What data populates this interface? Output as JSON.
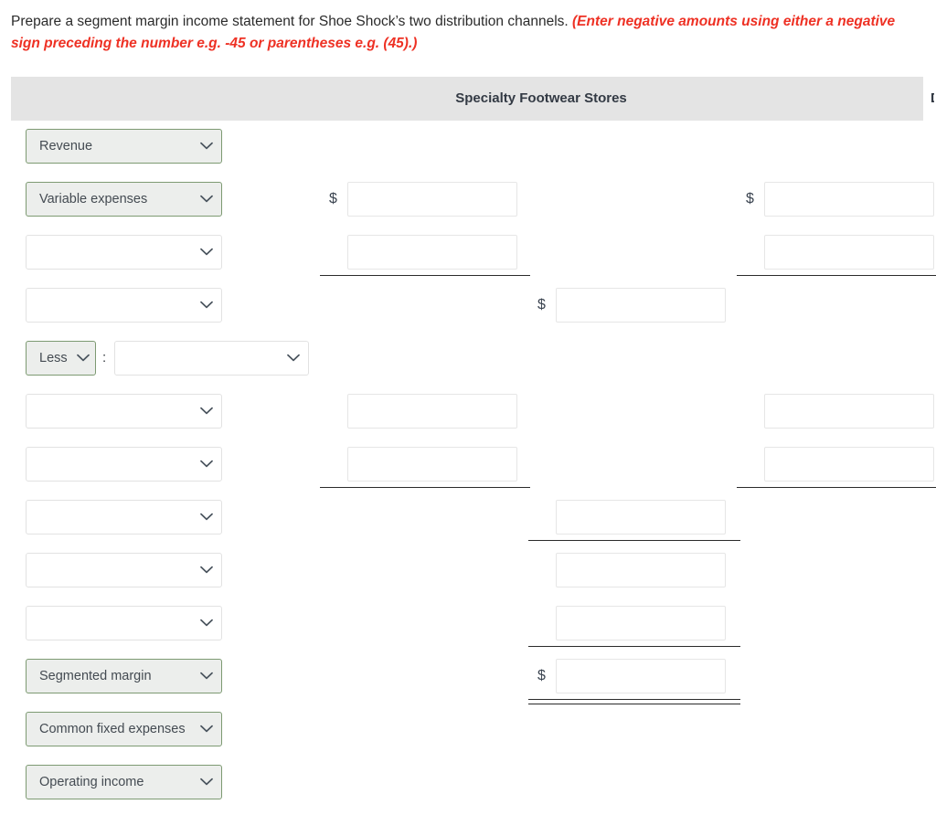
{
  "instructions": {
    "prompt": "Prepare a segment margin income statement for Shoe Shock’s two distribution channels.",
    "hint": "(Enter negative amounts using either a negative sign preceding the number e.g. -45 or parentheses e.g. (45).)"
  },
  "header": {
    "columns": [
      {
        "label": "Specialty Footwear Stores"
      },
      {
        "label": "D"
      }
    ]
  },
  "symbols": {
    "dollar": "$",
    "colon": ":"
  },
  "rows": [
    {
      "name": "revenue",
      "select": {
        "value": "Revenue",
        "placeholder": "",
        "filled": true
      },
      "inputs": []
    },
    {
      "name": "variable-expenses",
      "select": {
        "value": "Variable expenses",
        "placeholder": "",
        "filled": true
      },
      "inputs": [
        {
          "col": "A",
          "value": "",
          "dollar": "$"
        },
        {
          "col": "C",
          "value": "",
          "dollar": "$"
        }
      ]
    },
    {
      "name": "blank-row-1",
      "select": {
        "value": "",
        "placeholder": "",
        "filled": false
      },
      "inputs": [
        {
          "col": "A",
          "value": "",
          "dollar": ""
        },
        {
          "col": "C",
          "value": "",
          "dollar": ""
        }
      ]
    },
    {
      "name": "contribution-margin-row",
      "select": {
        "value": "",
        "placeholder": "",
        "filled": false
      },
      "inputs": [
        {
          "col": "B",
          "value": "",
          "dollar": "$"
        }
      ]
    },
    {
      "name": "less-row",
      "select": {
        "value": "Less",
        "placeholder": "",
        "filled": true
      },
      "subselect": {
        "value": "",
        "placeholder": "",
        "filled": false
      },
      "inputs": []
    },
    {
      "name": "fixed-expense-row-1",
      "select": {
        "value": "",
        "placeholder": "",
        "filled": false
      },
      "inputs": [
        {
          "col": "A",
          "value": "",
          "dollar": ""
        },
        {
          "col": "C",
          "value": "",
          "dollar": ""
        }
      ]
    },
    {
      "name": "fixed-expense-row-2",
      "select": {
        "value": "",
        "placeholder": "",
        "filled": false
      },
      "inputs": [
        {
          "col": "A",
          "value": "",
          "dollar": ""
        },
        {
          "col": "C",
          "value": "",
          "dollar": ""
        }
      ]
    },
    {
      "name": "subtotal-row-1",
      "select": {
        "value": "",
        "placeholder": "",
        "filled": false
      },
      "inputs": [
        {
          "col": "B",
          "value": "",
          "dollar": ""
        }
      ]
    },
    {
      "name": "subtotal-row-2",
      "select": {
        "value": "",
        "placeholder": "",
        "filled": false
      },
      "inputs": [
        {
          "col": "B",
          "value": "",
          "dollar": ""
        }
      ]
    },
    {
      "name": "subtotal-row-3",
      "select": {
        "value": "",
        "placeholder": "",
        "filled": false
      },
      "inputs": [
        {
          "col": "B",
          "value": "",
          "dollar": ""
        }
      ]
    },
    {
      "name": "segmented-margin",
      "select": {
        "value": "Segmented margin",
        "placeholder": "",
        "filled": true
      },
      "inputs": [
        {
          "col": "B",
          "value": "",
          "dollar": "$"
        }
      ]
    },
    {
      "name": "common-fixed-expenses",
      "select": {
        "value": "Common fixed expenses",
        "placeholder": "",
        "filled": true
      },
      "inputs": []
    },
    {
      "name": "operating-income",
      "select": {
        "value": "Operating income",
        "placeholder": "",
        "filled": true
      },
      "inputs": []
    }
  ]
}
